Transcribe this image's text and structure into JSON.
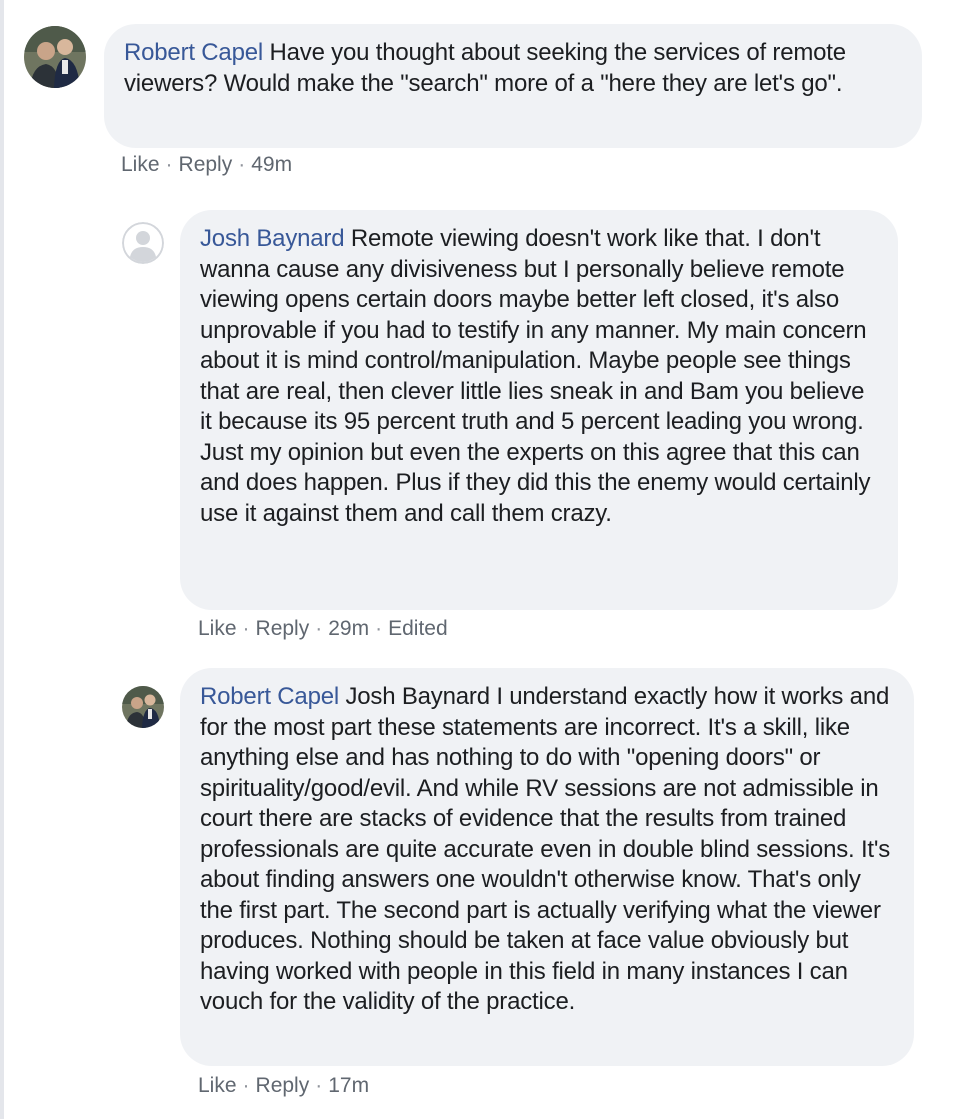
{
  "comments": [
    {
      "author": "Robert Capel",
      "text": "Have you thought about seeking the services of remote viewers? Would make the \"search\" more of a \"here they are let's go\".",
      "actions": {
        "like": "Like",
        "reply": "Reply",
        "time": "49m"
      }
    },
    {
      "author": "Josh Baynard",
      "text": "Remote viewing doesn't work like that. I don't wanna cause any divisiveness but I personally believe remote viewing opens certain doors maybe better left closed, it's also unprovable if you had to testify in any manner. My main concern about it is mind control/manipulation. Maybe people see things that are real, then clever little lies sneak in and Bam you believe it because its 95 percent truth and 5 percent leading you wrong. Just my opinion but even the experts on this agree that this can and does happen. Plus if they did this the enemy would certainly use it against them and call them crazy.",
      "actions": {
        "like": "Like",
        "reply": "Reply",
        "time": "29m",
        "edited": "Edited"
      }
    },
    {
      "author": "Robert Capel",
      "mention": "Josh Baynard",
      "text": "I understand exactly how it works and for the most part these statements are incorrect. It's a skill, like anything else and has nothing to do with \"opening doors\" or spirituality/good/evil. And while RV sessions are not admissible in court there are stacks of evidence that the results from trained professionals are quite accurate even in double blind sessions. It's about finding answers one wouldn't otherwise know. That's only the first part. The second part is actually verifying what the viewer produces. Nothing should be taken at face value obviously but having worked with people in this field in many instances I can vouch for the validity of the practice.",
      "actions": {
        "like": "Like",
        "reply": "Reply",
        "time": "17m"
      }
    }
  ],
  "separator": "·"
}
